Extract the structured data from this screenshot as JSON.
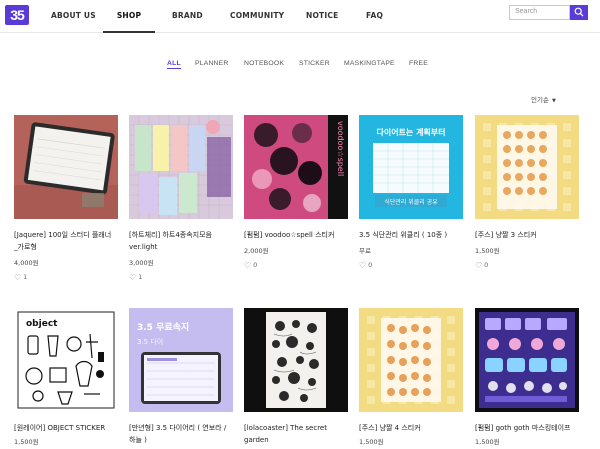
{
  "header": {
    "logo_text": "35",
    "nav": [
      "ABOUT US",
      "SHOP",
      "BRAND",
      "COMMUNITY",
      "NOTICE",
      "FAQ"
    ],
    "active_nav": "SHOP",
    "search_placeholder": "Search"
  },
  "categories": [
    "ALL",
    "PLANNER",
    "NOTEBOOK",
    "STICKER",
    "MASKINGTAPE",
    "FREE"
  ],
  "active_category": "ALL",
  "sort_label": "인기순",
  "products": [
    {
      "name_lines": [
        "[Jaquere] 100일 스터디 플래너",
        "_가로형"
      ],
      "price": "4,000원",
      "likes": "1"
    },
    {
      "name_lines": [
        "[하트체리] 하트4종속지모음",
        "ver.light"
      ],
      "price": "3,000원",
      "likes": "1"
    },
    {
      "name_lines": [
        "[펌펌] voodoo☆spell 스티커"
      ],
      "price": "2,000원",
      "likes": "0"
    },
    {
      "name_lines": [
        "3.5 식단관리 위클리 ( 10종 )"
      ],
      "price": "무료",
      "likes": "0"
    },
    {
      "name_lines": [
        "[주스] 냥짤 3 스티커"
      ],
      "price": "1,500원",
      "likes": "0"
    },
    {
      "name_lines": [
        "[원레이어] OBJECT STICKER"
      ],
      "price": "1,500원",
      "likes": ""
    },
    {
      "name_lines": [
        "[만년형] 3.5 다이어리 ( 연보라 /",
        "하늘 )"
      ],
      "price": "",
      "likes": ""
    },
    {
      "name_lines": [
        "[lolacoaster] The secret",
        "garden"
      ],
      "price": "",
      "likes": ""
    },
    {
      "name_lines": [
        "[주스] 냥짤 4 스티커"
      ],
      "price": "1,500원",
      "likes": ""
    },
    {
      "name_lines": [
        "[펌펌] goth goth 마스킹테이프"
      ],
      "price": "1,500원",
      "likes": ""
    }
  ],
  "thumb_texts": {
    "p2_title": "voodoo☆spell",
    "p3_title": "다이어트는 계획부터",
    "p3_sub": "식단관리 위클리 공유",
    "p5_title": "object",
    "p6_title": "3.5 무료속지",
    "p6_sub": "3.5 다이"
  },
  "colors": {
    "accent": "#5b3bd8",
    "border": "#e6e6e6"
  }
}
